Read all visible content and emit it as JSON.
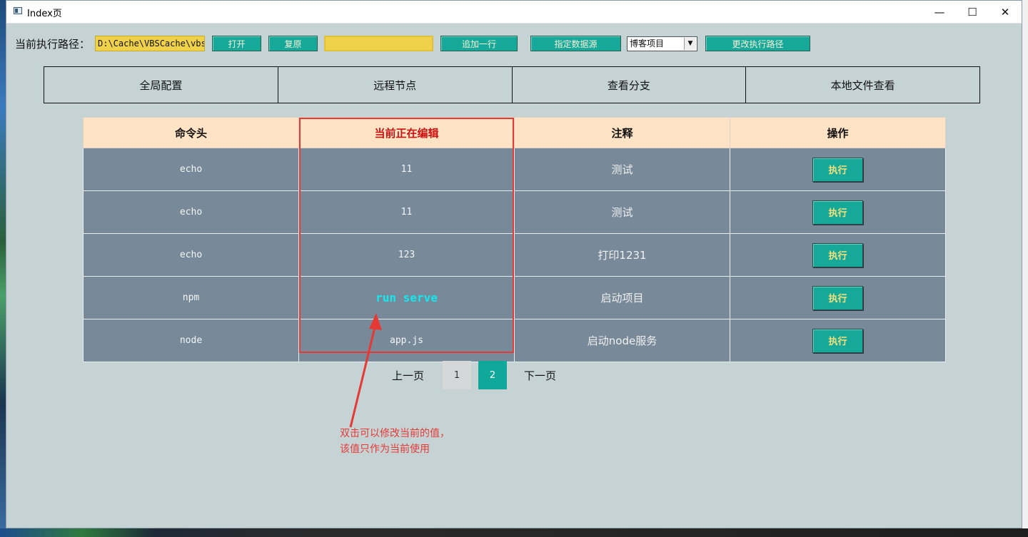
{
  "window": {
    "title": "Index页",
    "controls": {
      "minimize": "—",
      "maximize": "☐",
      "close": "✕"
    }
  },
  "toolbar": {
    "path_label": "当前执行路径：",
    "path_value": "D:\\Cache\\VBSCache\\vbs",
    "open_label": "打开",
    "reset_label": "复原",
    "add_row_label": "追加一行",
    "datasource_label": "指定数据源",
    "project_select_value": "博客项目",
    "change_path_label": "更改执行路径"
  },
  "tabs": [
    {
      "label": "全局配置"
    },
    {
      "label": "远程节点"
    },
    {
      "label": "查看分支"
    },
    {
      "label": "本地文件查看"
    }
  ],
  "table": {
    "headers": [
      "命令头",
      "当前正在编辑",
      "注释",
      "操作"
    ],
    "rows": [
      {
        "command": "echo",
        "value": "11",
        "note": "测试",
        "action": "执行"
      },
      {
        "command": "echo",
        "value": "11",
        "note": "测试",
        "action": "执行"
      },
      {
        "command": "echo",
        "value": "123",
        "note": "打印1231",
        "action": "执行"
      },
      {
        "command": "npm",
        "value": "run serve",
        "note": "启动项目",
        "action": "执行",
        "editing": true
      },
      {
        "command": "node",
        "value": "app.js",
        "note": "启动node服务",
        "action": "执行"
      }
    ]
  },
  "pagination": {
    "prev_label": "上一页",
    "pages": [
      "1",
      "2"
    ],
    "current_page": "2",
    "next_label": "下一页"
  },
  "annotation": {
    "line1": "双击可以修改当前的值，",
    "line2": "该值只作为当前使用"
  },
  "colors": {
    "window_bg": "#c6d3d5",
    "button_teal": "#16a898",
    "input_yellow": "#f0d24a",
    "header_peach": "#ffe3c4",
    "row_slate": "#788a99",
    "highlight_red": "#e53935"
  }
}
